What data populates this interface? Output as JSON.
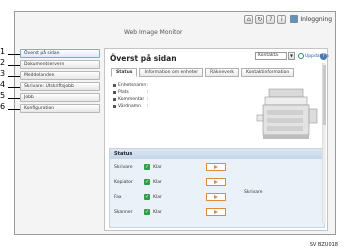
{
  "app": {
    "title": "Web Image Monitor"
  },
  "topbar": {
    "login_label": "Inloggning"
  },
  "sidebar": {
    "items": [
      {
        "label": "Överst på sidan",
        "callout": "1"
      },
      {
        "label": "Dokumentservern",
        "callout": "2"
      },
      {
        "label": "Meddelanden",
        "callout": "3"
      },
      {
        "label": "Skrivare: Utskriftsjobb",
        "callout": "4"
      },
      {
        "label": "Jobb",
        "callout": "5"
      },
      {
        "label": "Konfiguration",
        "callout": "6"
      }
    ]
  },
  "main": {
    "title": "Överst på sidan",
    "select_value": "Kontakta",
    "refresh_label": "Uppdatera",
    "tabs": [
      "Status",
      "Information om enheter",
      "Räkneverk",
      "Kontaktinformation"
    ],
    "info_rows": [
      {
        "label": "Enhetsnamn",
        "value": ":"
      },
      {
        "label": "Plats",
        "value": ":"
      },
      {
        "label": "Kommentar",
        "value": ":"
      },
      {
        "label": "Värdnamn",
        "value": ":"
      }
    ]
  },
  "status": {
    "title": "Status",
    "rows": [
      {
        "label": "Skrivare",
        "value": "Klar"
      },
      {
        "label": "Kopiator",
        "value": "Klar"
      },
      {
        "label": "Fax",
        "value": "Klar"
      },
      {
        "label": "Skanner",
        "value": "Klar"
      }
    ],
    "right_label": "Skrivare"
  },
  "figure_ref": "SV BZU018",
  "colors": {
    "ok": "#2f9e45",
    "arrow_button": "#e08a3a",
    "status_bg": "#eaf1f8"
  }
}
